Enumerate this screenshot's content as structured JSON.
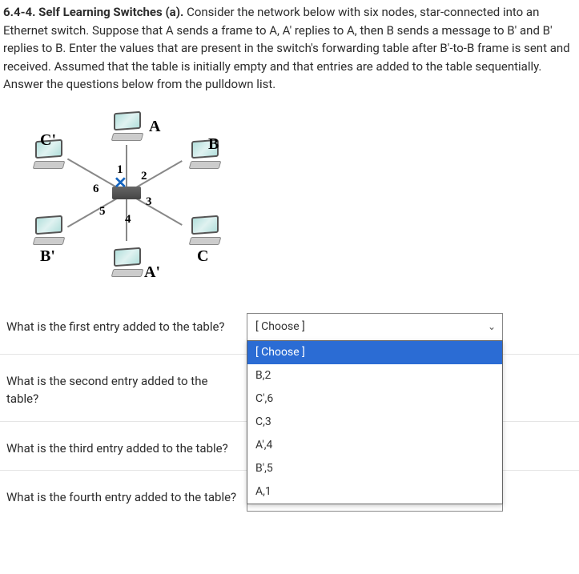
{
  "header": {
    "number": "6.4-4.",
    "title": "Self Learning Switches (a).",
    "body": "Consider the network below with six nodes, star-connected into an Ethernet switch. Suppose that A sends a frame to A, A' replies to A, then B sends a message to B' and B' replies to B.  Enter the values that are present in the switch's forwarding table after B'-to-B frame is sent and received.  Assumed that the table is initially empty and that entries are added to the table sequentially.  Answer the questions below from the pulldown list."
  },
  "diagram": {
    "nodes": {
      "A": "A",
      "B": "B",
      "C": "C",
      "Ap": "A'",
      "Bp": "B'",
      "Cp": "C'"
    },
    "ports": {
      "p1": "1",
      "p2": "2",
      "p3": "3",
      "p4": "4",
      "p5": "5",
      "p6": "6"
    }
  },
  "dropdown": {
    "placeholder": "[ Choose ]",
    "options": [
      "[ Choose ]",
      "B,2",
      "C',6",
      "C,3",
      "A',4",
      "B',5",
      "A,1"
    ]
  },
  "questions": {
    "q1": "What is the first entry added to the table?",
    "q2": "What is the second entry added to the table?",
    "q3": "What is the third entry added to the table?",
    "q4": "What is the fourth entry added to the table?"
  }
}
